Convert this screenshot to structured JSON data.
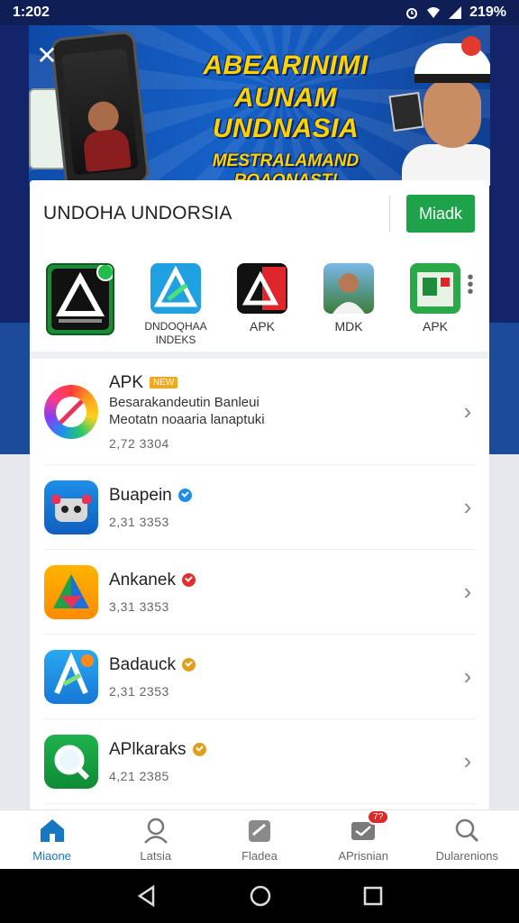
{
  "status_bar": {
    "time": "1:202",
    "battery": "219%"
  },
  "banner": {
    "line1": "ABEARINIMI",
    "line2": "AUNAM UNDNASIA",
    "line3": "MESTRALAMAND ROAONAST!",
    "close_icon": "close-icon"
  },
  "header": {
    "title": "UNDOHA UNDORSIA",
    "button_label": "Miadk",
    "accent": "#1fa34a"
  },
  "featured": [
    {
      "label": "",
      "icon": "apk-green-icon"
    },
    {
      "label": "DNDOQHAA INDEKS",
      "icon": "blue-a-icon"
    },
    {
      "label": "APK",
      "icon": "red-apk-icon"
    },
    {
      "label": "MDK",
      "icon": "portrait-icon"
    },
    {
      "label": "APK",
      "icon": "green-apk-icon"
    }
  ],
  "list": [
    {
      "title": "APK",
      "badge": "NEW",
      "desc1": "Besarakandeutin Banleui",
      "desc2": "Meotatn noaaria lanaptuki",
      "count": "2,72 3304",
      "icon": "ring-icon"
    },
    {
      "title": "Buapein",
      "count": "2,31 3353",
      "icon": "robot-icon",
      "verify_color": "#1d8ee8"
    },
    {
      "title": "Ankanek",
      "count": "3,31 3353",
      "icon": "triangle-icon",
      "verify_color": "#e03030"
    },
    {
      "title": "Badauck",
      "count": "2,31 2353",
      "icon": "a-play-icon",
      "verify_color": "#e0a01c"
    },
    {
      "title": "APlkaraks",
      "count": "4,21 2385",
      "icon": "magnifier-icon",
      "verify_color": "#e0a01c"
    }
  ],
  "bottom_nav": [
    {
      "label": "Miaone",
      "icon": "home-icon",
      "active": true
    },
    {
      "label": "Latsia",
      "icon": "person-icon"
    },
    {
      "label": "Fladea",
      "icon": "edit-icon"
    },
    {
      "label": "APrisnian",
      "icon": "inbox-icon",
      "badge": "7?"
    },
    {
      "label": "Dularenions",
      "icon": "search-icon"
    }
  ]
}
